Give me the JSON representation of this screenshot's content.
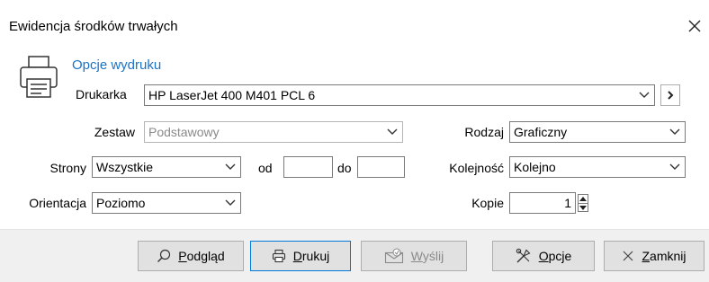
{
  "window": {
    "title": "Ewidencja środków trwałych"
  },
  "section": {
    "title": "Opcje wydruku"
  },
  "printer": {
    "label": "Drukarka",
    "value": "HP LaserJet 400 M401 PCL 6"
  },
  "zestaw": {
    "label": "Zestaw",
    "value": "Podstawowy"
  },
  "rodzaj": {
    "label": "Rodzaj",
    "value": "Graficzny"
  },
  "strony": {
    "label": "Strony",
    "value": "Wszystkie"
  },
  "od": {
    "label": "od",
    "value": ""
  },
  "do": {
    "label": "do",
    "value": ""
  },
  "kolejnosc": {
    "label": "Kolejność",
    "value": "Kolejno"
  },
  "orientacja": {
    "label": "Orientacja",
    "value": "Poziomo"
  },
  "kopie": {
    "label": "Kopie",
    "value": "1"
  },
  "buttons": {
    "podglad": {
      "mnemonic": "P",
      "rest": "odgląd"
    },
    "drukuj": {
      "mnemonic": "D",
      "rest": "rukuj"
    },
    "wyslij": {
      "mnemonic": "W",
      "rest": "yślij"
    },
    "opcje": {
      "mnemonic": "O",
      "rest": "pcje"
    },
    "zamknij": {
      "mnemonic": "Z",
      "rest": "amknij"
    }
  },
  "colors": {
    "accent": "#1a73c8",
    "footer_bg": "#f0f0f0",
    "button_bg": "#e1e1e1",
    "focus_border": "#0078d7"
  },
  "icons": [
    "close-icon",
    "printer-icon",
    "chevron-down-icon",
    "chevron-right-icon",
    "search-icon",
    "print-icon",
    "mail-icon",
    "tools-icon"
  ]
}
